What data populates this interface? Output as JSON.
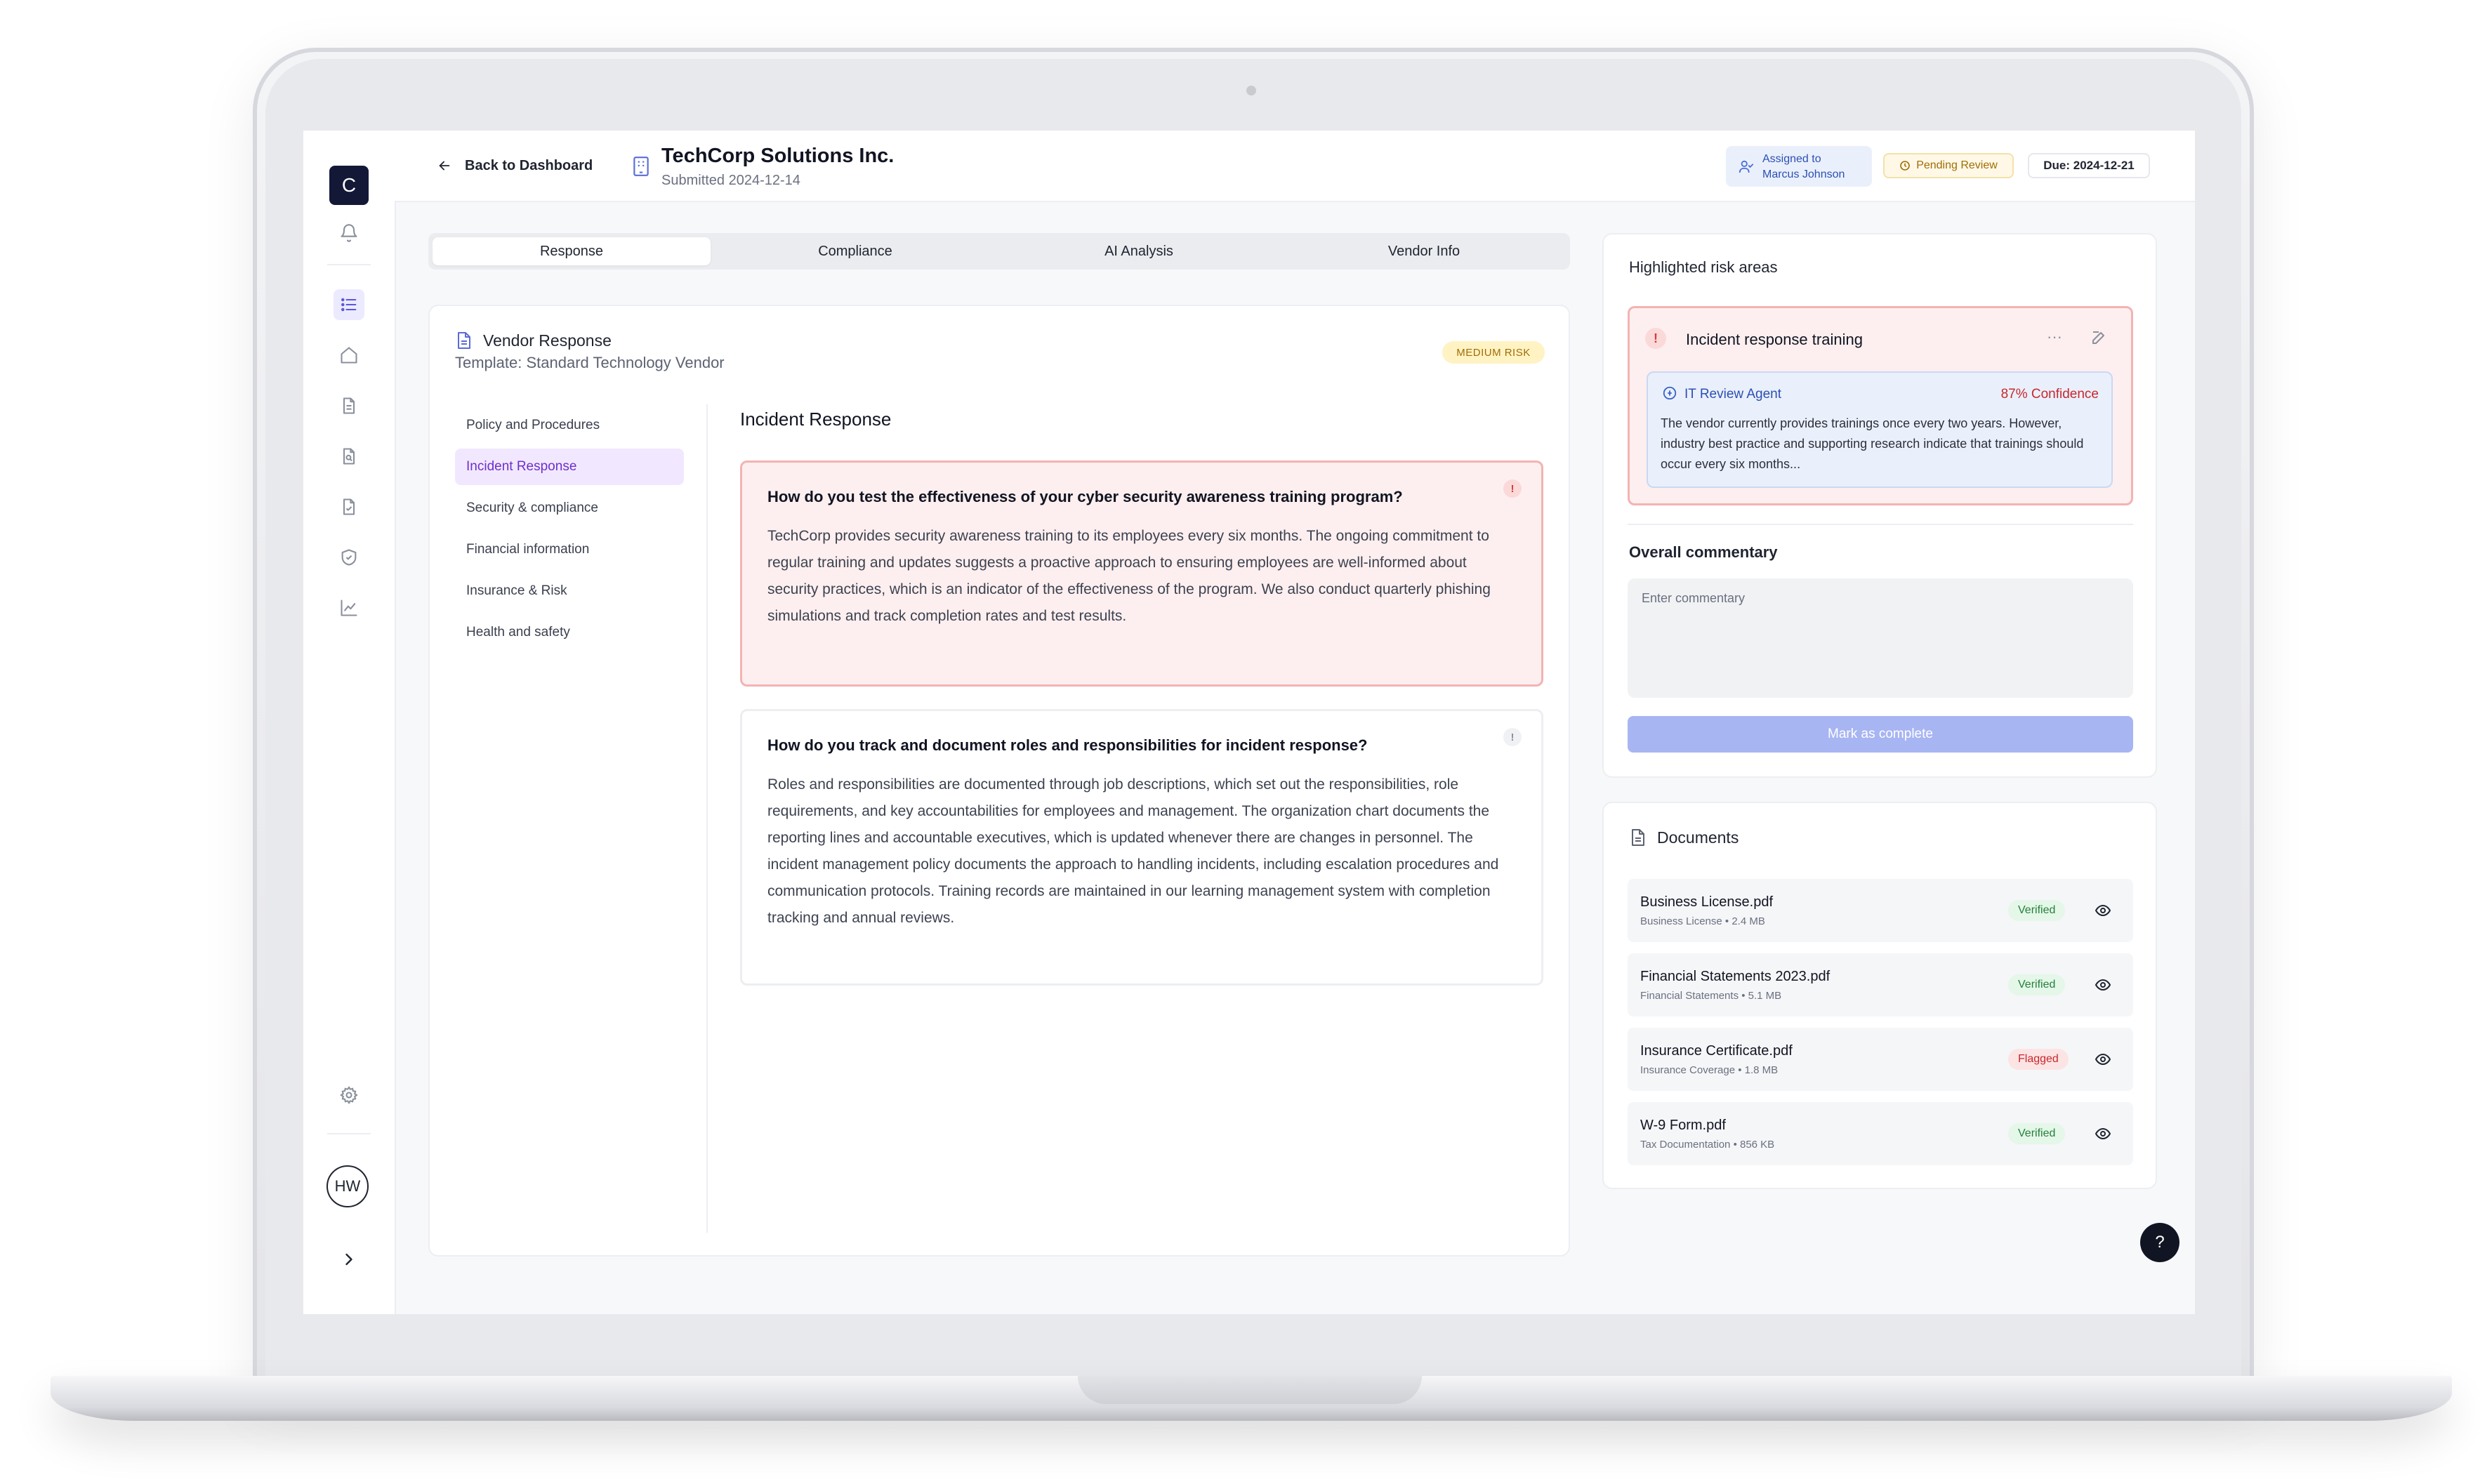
{
  "sidebar": {
    "logo_letter": "C",
    "icons": [
      "bell-icon",
      "list-icon",
      "home-icon",
      "file-icon",
      "file-search-icon",
      "file-check-icon",
      "shield-icon",
      "chart-line-icon",
      "gear-icon"
    ],
    "user_initials": "HW"
  },
  "header": {
    "back_label": "Back to Dashboard",
    "company": "TechCorp Solutions Inc.",
    "submitted": "Submitted 2024-12-14",
    "assigned_label": "Assigned to",
    "assigned_name": "Marcus Johnson",
    "status": "Pending Review",
    "due": "Due: 2024-12-21"
  },
  "tabs": [
    "Response",
    "Compliance",
    "AI Analysis",
    "Vendor Info"
  ],
  "vendor_response": {
    "title": "Vendor Response",
    "template": "Template: Standard Technology Vendor",
    "risk_badge": "MEDIUM RISK"
  },
  "nav": [
    "Policy and Procedures",
    "Incident Response",
    "Security & compliance",
    "Financial information",
    "Insurance & Risk",
    "Health and safety"
  ],
  "section_title": "Incident Response",
  "questions": [
    {
      "mark": "!",
      "question": "How do you test the effectiveness of your cyber security awareness training program?",
      "answer": "TechCorp provides security awareness training to its employees every six months. The ongoing commitment to regular training and updates suggests a proactive approach to ensuring employees are well-informed about security practices, which is an indicator of the effectiveness of the program. We also conduct quarterly phishing simulations and track completion rates and test results."
    },
    {
      "mark": "!",
      "question": "How do you track and document roles and responsibilities for incident response?",
      "answer": "Roles and responsibilities are documented through job descriptions, which set out the responsibilities, role requirements, and key accountabilities for employees and management. The organization chart documents the reporting lines and accountable executives, which is updated whenever there are changes in personnel. The incident management policy documents the approach to handling incidents, including escalation procedures and communication protocols. Training records are maintained in our learning management system with completion tracking and annual reviews."
    }
  ],
  "risk_panel": {
    "title": "Highlighted risk areas",
    "card_mark": "!",
    "card_title": "Incident response training",
    "more": "···",
    "agent_name": "IT Review Agent",
    "confidence": "87% Confidence",
    "agent_text": "The vendor currently provides trainings once every two years. However, industry best practice and supporting research indicate that trainings should occur every six months...",
    "commentary_title": "Overall commentary",
    "commentary_placeholder": "Enter commentary",
    "complete_label": "Mark as complete"
  },
  "documents": {
    "title": "Documents",
    "items": [
      {
        "name": "Business License.pdf",
        "meta": "Business License • 2.4 MB",
        "status": "Verified"
      },
      {
        "name": "Financial Statements 2023.pdf",
        "meta": "Financial Statements • 5.1 MB",
        "status": "Verified"
      },
      {
        "name": "Insurance Certificate.pdf",
        "meta": "Insurance Coverage • 1.8 MB",
        "status": "Flagged"
      },
      {
        "name": "W-9 Form.pdf",
        "meta": "Tax Documentation • 856 KB",
        "status": "Verified"
      }
    ]
  },
  "help": "?",
  "colors": {
    "accent": "#5b57d6",
    "danger": "#c7282d",
    "success": "#25803c",
    "warning": "#a06d05"
  }
}
